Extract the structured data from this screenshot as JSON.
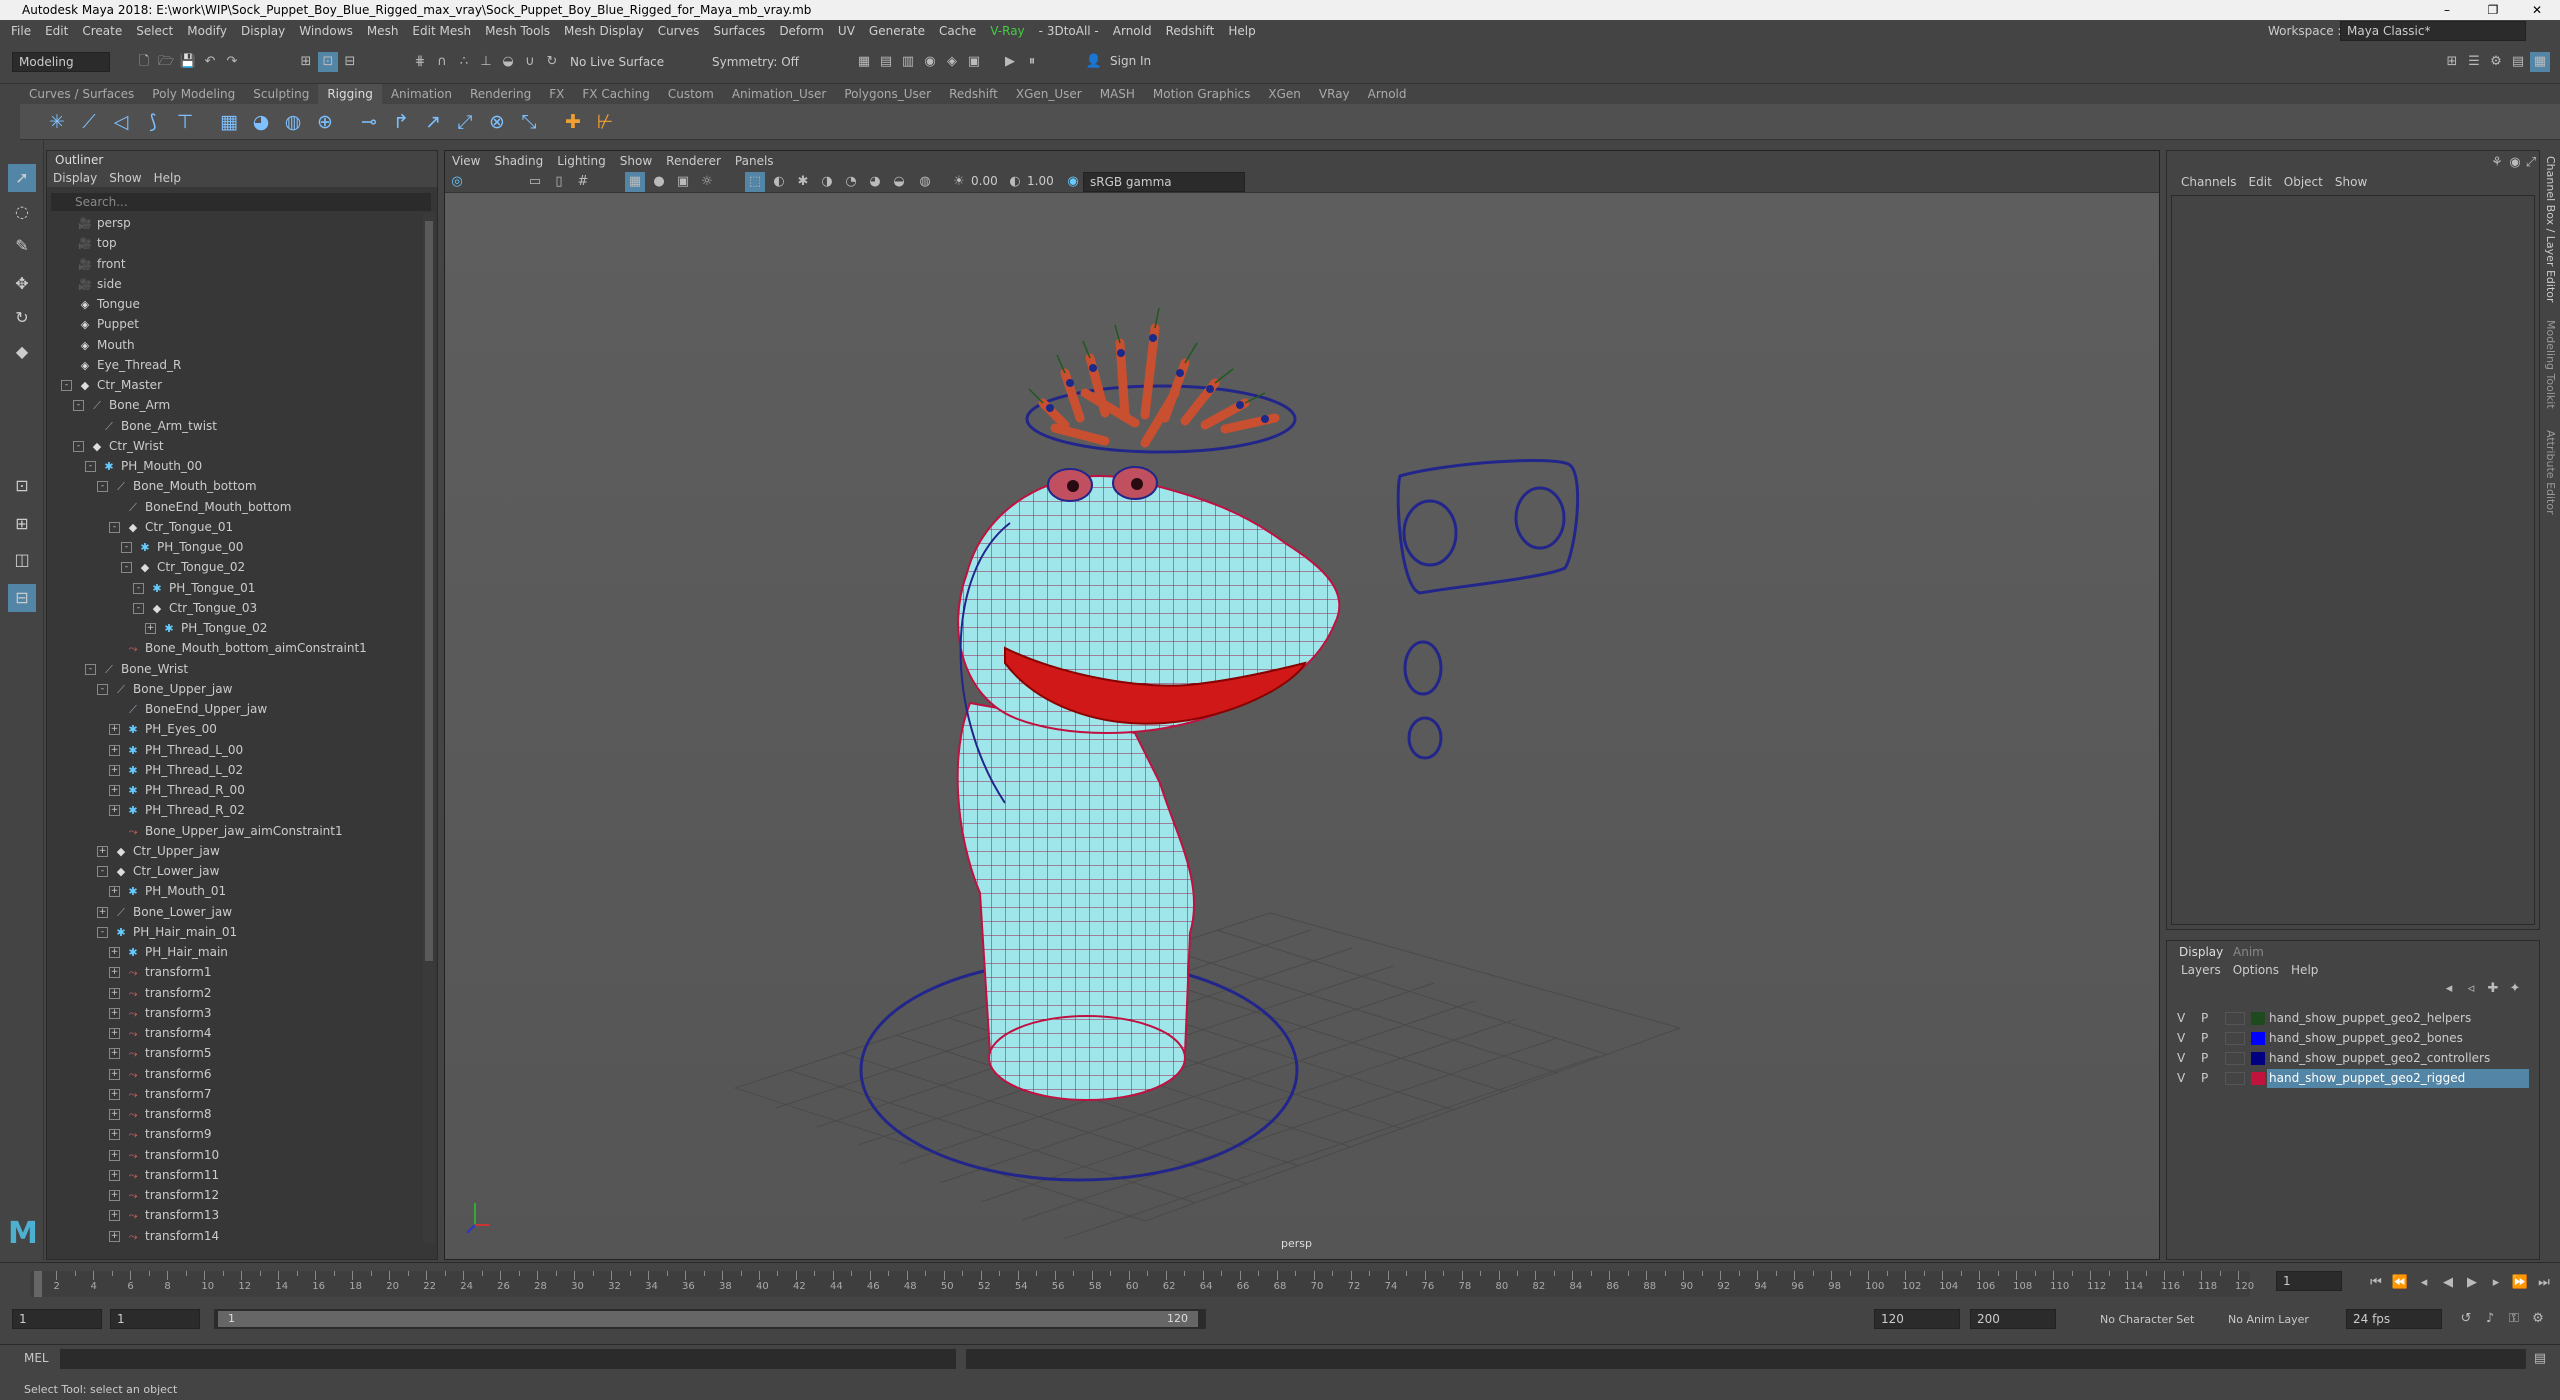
{
  "window": {
    "title": "Autodesk Maya 2018: E:\\work\\WIP\\Sock_Puppet_Boy_Blue_Rigged_max_vray\\Sock_Puppet_Boy_Blue_Rigged_for_Maya_mb_vray.mb",
    "minimize": "–",
    "maximize": "❐",
    "close": "✕"
  },
  "menu": [
    "File",
    "Edit",
    "Create",
    "Select",
    "Modify",
    "Display",
    "Windows",
    "Mesh",
    "Edit Mesh",
    "Mesh Tools",
    "Mesh Display",
    "Curves",
    "Surfaces",
    "Deform",
    "UV",
    "Generate",
    "Cache",
    "V-Ray",
    "- 3DtoAll -",
    "Arnold",
    "Redshift",
    "Help"
  ],
  "workspace": {
    "label": "Workspace :",
    "value": "Maya Classic*"
  },
  "status": {
    "mode": "Modeling",
    "symmetry": "Symmetry: Off",
    "live_surface": "No Live Surface",
    "sign_in": "Sign In"
  },
  "shelf_tabs": [
    "Curves / Surfaces",
    "Poly Modeling",
    "Sculpting",
    "Rigging",
    "Animation",
    "Rendering",
    "FX",
    "FX Caching",
    "Custom",
    "Animation_User",
    "Polygons_User",
    "Redshift",
    "XGen_User",
    "MASH",
    "Motion Graphics",
    "XGen",
    "VRay",
    "Arnold"
  ],
  "active_shelf": "Rigging",
  "outliner": {
    "title": "Outliner",
    "menu": [
      "Display",
      "Show",
      "Help"
    ],
    "search_placeholder": "Search...",
    "items": [
      {
        "label": "persp",
        "depth": 0,
        "icon": "cam",
        "exp": ""
      },
      {
        "label": "top",
        "depth": 0,
        "icon": "cam",
        "exp": ""
      },
      {
        "label": "front",
        "depth": 0,
        "icon": "cam",
        "exp": ""
      },
      {
        "label": "side",
        "depth": 0,
        "icon": "cam",
        "exp": ""
      },
      {
        "label": "Tongue",
        "depth": 0,
        "icon": "mesh",
        "exp": ""
      },
      {
        "label": "Puppet",
        "depth": 0,
        "icon": "mesh",
        "exp": ""
      },
      {
        "label": "Mouth",
        "depth": 0,
        "icon": "mesh",
        "exp": ""
      },
      {
        "label": "Eye_Thread_R",
        "depth": 0,
        "icon": "mesh",
        "exp": ""
      },
      {
        "label": "Ctr_Master",
        "depth": 0,
        "icon": "ctr",
        "exp": "-"
      },
      {
        "label": "Bone_Arm",
        "depth": 1,
        "icon": "bone",
        "exp": "-"
      },
      {
        "label": "Bone_Arm_twist",
        "depth": 2,
        "icon": "bone",
        "exp": ""
      },
      {
        "label": "Ctr_Wrist",
        "depth": 1,
        "icon": "ctr",
        "exp": "-"
      },
      {
        "label": "PH_Mouth_00",
        "depth": 2,
        "icon": "ph",
        "exp": "-"
      },
      {
        "label": "Bone_Mouth_bottom",
        "depth": 3,
        "icon": "bone",
        "exp": "-"
      },
      {
        "label": "BoneEnd_Mouth_bottom",
        "depth": 4,
        "icon": "bone",
        "exp": ""
      },
      {
        "label": "Ctr_Tongue_01",
        "depth": 4,
        "icon": "ctr",
        "exp": "-"
      },
      {
        "label": "PH_Tongue_00",
        "depth": 5,
        "icon": "ph",
        "exp": "-"
      },
      {
        "label": "Ctr_Tongue_02",
        "depth": 5,
        "icon": "ctr",
        "exp": "-"
      },
      {
        "label": "PH_Tongue_01",
        "depth": 6,
        "icon": "ph",
        "exp": "-"
      },
      {
        "label": "Ctr_Tongue_03",
        "depth": 6,
        "icon": "ctr",
        "exp": "-"
      },
      {
        "label": "PH_Tongue_02",
        "depth": 7,
        "icon": "ph",
        "exp": "+"
      },
      {
        "label": "Bone_Mouth_bottom_aimConstraint1",
        "depth": 4,
        "icon": "con",
        "exp": ""
      },
      {
        "label": "Bone_Wrist",
        "depth": 2,
        "icon": "bone",
        "exp": "-"
      },
      {
        "label": "Bone_Upper_jaw",
        "depth": 3,
        "icon": "bone",
        "exp": "-"
      },
      {
        "label": "BoneEnd_Upper_jaw",
        "depth": 4,
        "icon": "bone",
        "exp": ""
      },
      {
        "label": "PH_Eyes_00",
        "depth": 4,
        "icon": "ph",
        "exp": "+"
      },
      {
        "label": "PH_Thread_L_00",
        "depth": 4,
        "icon": "ph",
        "exp": "+"
      },
      {
        "label": "PH_Thread_L_02",
        "depth": 4,
        "icon": "ph",
        "exp": "+"
      },
      {
        "label": "PH_Thread_R_00",
        "depth": 4,
        "icon": "ph",
        "exp": "+"
      },
      {
        "label": "PH_Thread_R_02",
        "depth": 4,
        "icon": "ph",
        "exp": "+"
      },
      {
        "label": "Bone_Upper_jaw_aimConstraint1",
        "depth": 4,
        "icon": "con",
        "exp": ""
      },
      {
        "label": "Ctr_Upper_jaw",
        "depth": 3,
        "icon": "ctr",
        "exp": "+"
      },
      {
        "label": "Ctr_Lower_jaw",
        "depth": 3,
        "icon": "ctr",
        "exp": "-"
      },
      {
        "label": "PH_Mouth_01",
        "depth": 4,
        "icon": "ph",
        "exp": "+"
      },
      {
        "label": "Bone_Lower_jaw",
        "depth": 3,
        "icon": "bone",
        "exp": "+"
      },
      {
        "label": "PH_Hair_main_01",
        "depth": 3,
        "icon": "ph",
        "exp": "-"
      },
      {
        "label": "PH_Hair_main",
        "depth": 4,
        "icon": "ph",
        "exp": "+"
      },
      {
        "label": "transform1",
        "depth": 4,
        "icon": "con",
        "exp": "+"
      },
      {
        "label": "transform2",
        "depth": 4,
        "icon": "con",
        "exp": "+"
      },
      {
        "label": "transform3",
        "depth": 4,
        "icon": "con",
        "exp": "+"
      },
      {
        "label": "transform4",
        "depth": 4,
        "icon": "con",
        "exp": "+"
      },
      {
        "label": "transform5",
        "depth": 4,
        "icon": "con",
        "exp": "+"
      },
      {
        "label": "transform6",
        "depth": 4,
        "icon": "con",
        "exp": "+"
      },
      {
        "label": "transform7",
        "depth": 4,
        "icon": "con",
        "exp": "+"
      },
      {
        "label": "transform8",
        "depth": 4,
        "icon": "con",
        "exp": "+"
      },
      {
        "label": "transform9",
        "depth": 4,
        "icon": "con",
        "exp": "+"
      },
      {
        "label": "transform10",
        "depth": 4,
        "icon": "con",
        "exp": "+"
      },
      {
        "label": "transform11",
        "depth": 4,
        "icon": "con",
        "exp": "+"
      },
      {
        "label": "transform12",
        "depth": 4,
        "icon": "con",
        "exp": "+"
      },
      {
        "label": "transform13",
        "depth": 4,
        "icon": "con",
        "exp": "+"
      },
      {
        "label": "transform14",
        "depth": 4,
        "icon": "con",
        "exp": "+"
      }
    ]
  },
  "viewport": {
    "menu": [
      "View",
      "Shading",
      "Lighting",
      "Show",
      "Renderer",
      "Panels"
    ],
    "exposure": "0.00",
    "gamma": "1.00",
    "color_space": "sRGB gamma",
    "camera_label": "persp"
  },
  "channel_box": {
    "menu": [
      "Channels",
      "Edit",
      "Object",
      "Show"
    ]
  },
  "side_tabs": [
    "Channel Box / Layer Editor",
    "Modeling Toolkit",
    "Attribute Editor"
  ],
  "layer_editor": {
    "tabs": [
      "Display",
      "Anim"
    ],
    "menu": [
      "Layers",
      "Options",
      "Help"
    ],
    "layers": [
      {
        "v": "V",
        "p": "P",
        "name": "hand_show_puppet_geo2_helpers",
        "color": "#1f4a1f",
        "selected": false
      },
      {
        "v": "V",
        "p": "P",
        "name": "hand_show_puppet_geo2_bones",
        "color": "#0000ff",
        "selected": false
      },
      {
        "v": "V",
        "p": "P",
        "name": "hand_show_puppet_geo2_controllers",
        "color": "#000080",
        "selected": false
      },
      {
        "v": "V",
        "p": "P",
        "name": "hand_show_puppet_geo2_rigged",
        "color": "#c0143c",
        "selected": true
      }
    ]
  },
  "timeline": {
    "current_frame": "1",
    "ticks": [
      "1",
      "2",
      "4",
      "6",
      "8",
      "10",
      "12",
      "14",
      "16",
      "18",
      "20",
      "22",
      "24",
      "26",
      "28",
      "30",
      "32",
      "34",
      "36",
      "38",
      "40",
      "42",
      "44",
      "46",
      "48",
      "50",
      "52",
      "54",
      "56",
      "58",
      "60",
      "62",
      "64",
      "66",
      "68",
      "70",
      "72",
      "74",
      "76",
      "78",
      "80",
      "82",
      "84",
      "86",
      "88",
      "90",
      "92",
      "94",
      "96",
      "98",
      "100",
      "102",
      "104",
      "106",
      "108",
      "110",
      "112",
      "114",
      "116",
      "118",
      "120"
    ]
  },
  "range": {
    "start": "1",
    "start2": "1",
    "slider_start": "1",
    "slider_end": "120",
    "end": "120",
    "end2": "200",
    "character_set": "No Character Set",
    "anim_layer": "No Anim Layer",
    "fps": "24 fps"
  },
  "cmdline": {
    "label": "MEL"
  },
  "helpline": {
    "text": "Select Tool: select an object"
  }
}
